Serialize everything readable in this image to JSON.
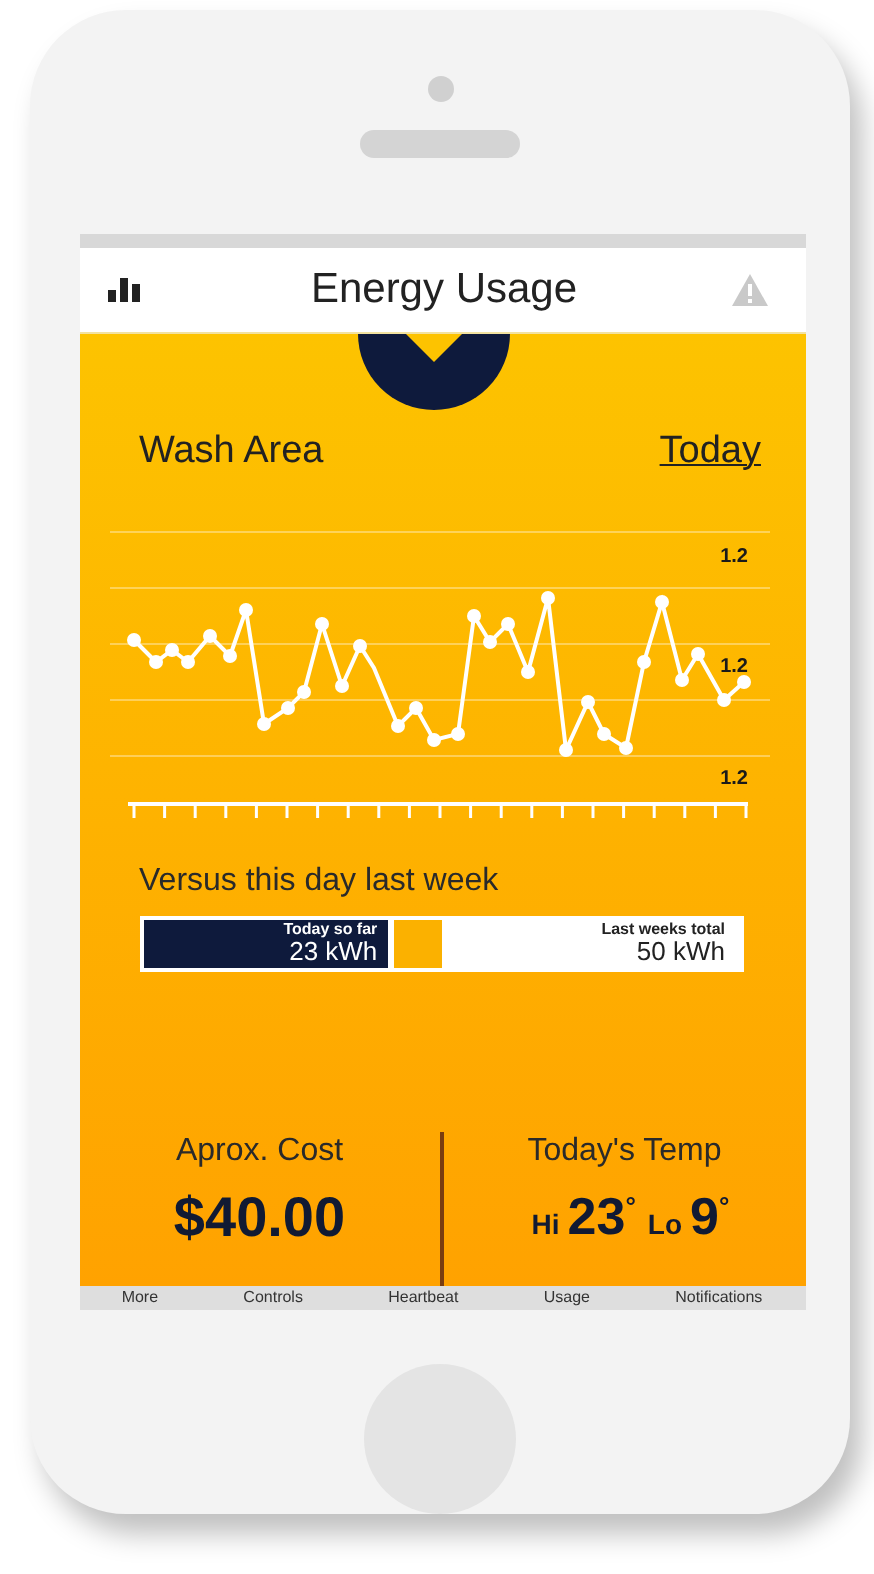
{
  "header": {
    "title": "Energy Usage"
  },
  "section": {
    "title": "Wash Area",
    "period_link": "Today"
  },
  "chart": {
    "axis_labels": [
      "1.2",
      "1.2",
      "1.2"
    ]
  },
  "comparison": {
    "title": "Versus this day last week",
    "level": 0.41,
    "today": {
      "label": "Today so far",
      "value": "23 kWh"
    },
    "last_week": {
      "label": "Last weeks total",
      "value": "50 kWh"
    }
  },
  "cost": {
    "label": "Aprox. Cost",
    "value": "$40.00"
  },
  "temperature": {
    "label": "Today's Temp",
    "hi_label": "Hi",
    "hi": "23$^{°}$",
    "lo_label": "Lo",
    "lo": "9$^{°}$"
  },
  "tabs": [
    {
      "label": "More"
    },
    {
      "label": "Controls"
    },
    {
      "label": "Heartbeat"
    },
    {
      "label": "Usage"
    },
    {
      "label": "Notifications"
    }
  ]
}
